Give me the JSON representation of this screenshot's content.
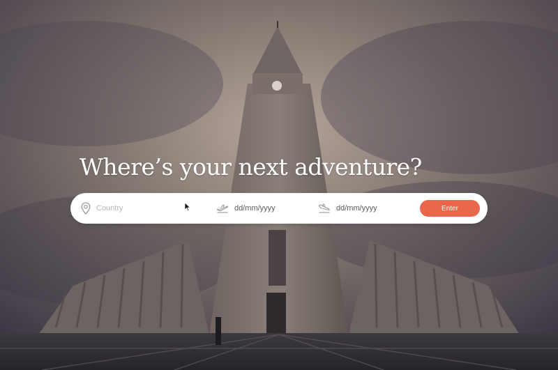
{
  "hero": {
    "headline": "Where’s your next adventure?"
  },
  "search": {
    "country_placeholder": "Country",
    "country_icon": "location-pin-icon",
    "departure_value": "dd/mm/yyyy",
    "departure_icon": "plane-takeoff-icon",
    "return_value": "dd/mm/yyyy",
    "return_icon": "plane-landing-icon",
    "enter_label": "Enter"
  },
  "colors": {
    "accent": "#e8674b",
    "bar_background": "#ffffff",
    "headline": "#ffffff",
    "icon": "#9a9a9a"
  }
}
